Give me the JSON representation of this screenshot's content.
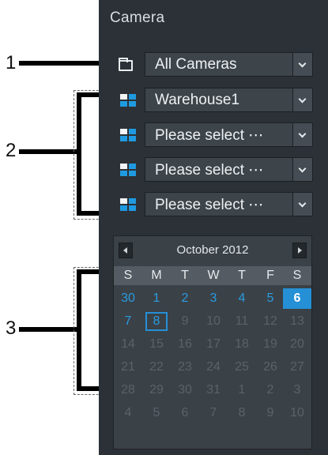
{
  "panel": {
    "title": "Camera",
    "camera_group": {
      "value": "All Cameras"
    },
    "camera_slots": [
      {
        "value": "Warehouse1"
      },
      {
        "value": "Please select ⋯"
      },
      {
        "value": "Please select ⋯"
      },
      {
        "value": "Please select ⋯"
      }
    ]
  },
  "calendar": {
    "month_label": "October 2012",
    "weekdays": [
      "S",
      "M",
      "T",
      "W",
      "T",
      "F",
      "S"
    ],
    "weeks": [
      [
        "30",
        "1",
        "2",
        "3",
        "4",
        "5",
        "6"
      ],
      [
        "7",
        "8",
        "9",
        "10",
        "11",
        "12",
        "13"
      ],
      [
        "14",
        "15",
        "16",
        "17",
        "18",
        "19",
        "20"
      ],
      [
        "21",
        "22",
        "23",
        "24",
        "25",
        "26",
        "27"
      ],
      [
        "28",
        "29",
        "30",
        "31",
        "1",
        "2",
        "3"
      ],
      [
        "4",
        "5",
        "6",
        "7",
        "8",
        "9",
        "10"
      ]
    ],
    "highlight_color": "#2590d6"
  },
  "callouts": {
    "one": "1",
    "two": "2",
    "three": "3"
  },
  "icons": {
    "folder": "folder-icon",
    "grid": "layout-grid-icon",
    "dropdown": "chevron-down-icon",
    "prev": "triangle-left-icon",
    "next": "triangle-right-icon"
  }
}
